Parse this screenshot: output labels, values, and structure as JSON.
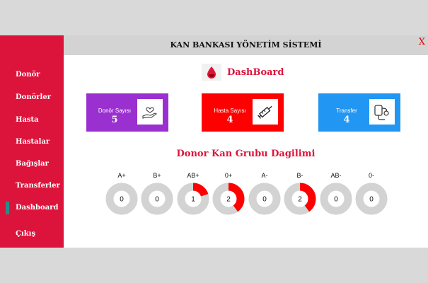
{
  "window": {
    "title": "KAN BANKASI YÖNETİM SİSTEMİ",
    "close_label": "X"
  },
  "sidebar": {
    "items": [
      {
        "label": "Donör"
      },
      {
        "label": "Donörler"
      },
      {
        "label": "Hasta"
      },
      {
        "label": "Hastalar"
      },
      {
        "label": "Bağışlar"
      },
      {
        "label": "Transferler"
      },
      {
        "label": "Dashboard",
        "active": true
      },
      {
        "label": "Çıkış"
      }
    ]
  },
  "brand": {
    "title": "DashBoard",
    "icon": "blood-drop-icon"
  },
  "cards": [
    {
      "label": "Donör Sayısı",
      "value": "5",
      "color": "#9b30d0",
      "icon": "donor-hand-heart-icon"
    },
    {
      "label": "Hasta Sayısı",
      "value": "4",
      "color": "#ff0000",
      "icon": "syringe-icon"
    },
    {
      "label": "Transfer",
      "value": "4",
      "color": "#2196f3",
      "icon": "blood-bag-stethoscope-icon"
    }
  ],
  "blood_groups": {
    "title": "Donor Kan Grubu Dagilimi",
    "groups": [
      {
        "name": "A+",
        "count": "0",
        "fraction": 0
      },
      {
        "name": "B+",
        "count": "0",
        "fraction": 0
      },
      {
        "name": "AB+",
        "count": "1",
        "fraction": 0.2
      },
      {
        "name": "0+",
        "count": "2",
        "fraction": 0.4
      },
      {
        "name": "A-",
        "count": "0",
        "fraction": 0
      },
      {
        "name": "B-",
        "count": "2",
        "fraction": 0.4
      },
      {
        "name": "AB-",
        "count": "0",
        "fraction": 0
      },
      {
        "name": "0-",
        "count": "0",
        "fraction": 0
      }
    ]
  },
  "colors": {
    "sidebar": "#dc143c",
    "ring_track": "#d3d3d3",
    "ring_fill": "#ff0000"
  }
}
